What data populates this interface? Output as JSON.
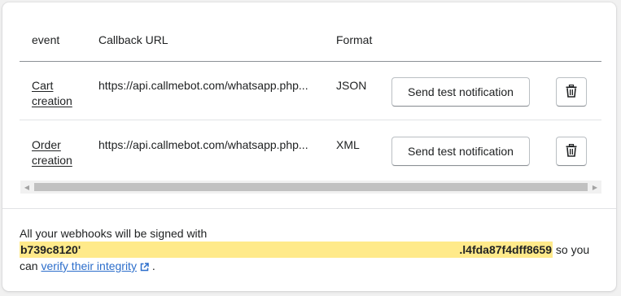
{
  "table": {
    "headers": {
      "event": "event",
      "callback_url": "Callback URL",
      "format": "Format"
    },
    "rows": [
      {
        "event": "Cart creation",
        "callback_url": "https://api.callmebot.com/whatsapp.php...",
        "format": "JSON",
        "test_button": "Send test notification",
        "delete_icon": "trash-icon"
      },
      {
        "event": "Order creation",
        "callback_url": "https://api.callmebot.com/whatsapp.php...",
        "format": "XML",
        "test_button": "Send test notification",
        "delete_icon": "trash-icon"
      }
    ]
  },
  "footer": {
    "text_before": "All your webhooks will be signed with",
    "signature_start": "b739c8120'",
    "signature_end": ".l4fda87f4dff8659",
    "text_after": "so you can",
    "link_text": "verify their integrity",
    "link_icon": "external-link-icon",
    "period": "."
  },
  "colors": {
    "link": "#2c6ecb",
    "highlight": "#ffea8a",
    "border": "#babfc3"
  }
}
